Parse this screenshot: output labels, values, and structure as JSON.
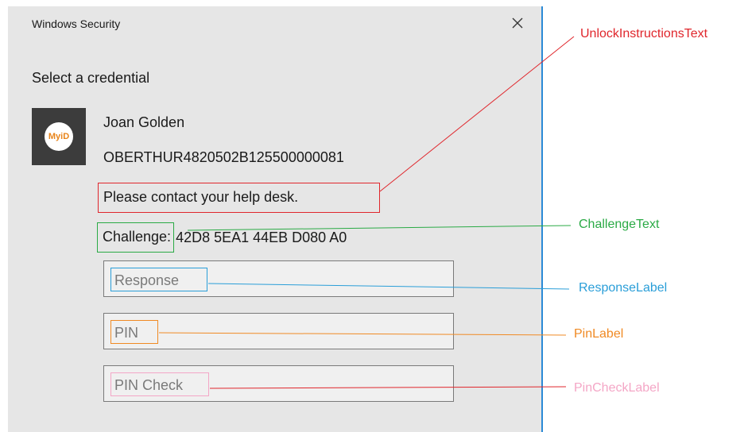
{
  "dialog": {
    "title": "Windows Security",
    "heading": "Select a credential",
    "avatar_text": "MyiD",
    "user_name": "Joan Golden",
    "card_id": "OBERTHUR4820502B125500000081",
    "unlock_instructions": "Please contact your help desk.",
    "challenge_label": "Challenge:",
    "challenge_value": "42D8 5EA1 44EB D080 A0",
    "response_placeholder": "Response",
    "pin_placeholder": "PIN",
    "pincheck_placeholder": "PIN Check"
  },
  "annotations": {
    "unlock": "UnlockInstructionsText",
    "challenge": "ChallengeText",
    "response": "ResponseLabel",
    "pin": "PinLabel",
    "pincheck": "PinCheckLabel"
  },
  "colors": {
    "unlock": "#e0262c",
    "challenge": "#2aaa45",
    "response": "#2a9ed8",
    "pin": "#f08a24",
    "pincheck": "#f4a6c6",
    "accent_border": "#2b8ad6"
  },
  "icons": {
    "close": "close-icon",
    "avatar": "myid-logo-icon"
  }
}
